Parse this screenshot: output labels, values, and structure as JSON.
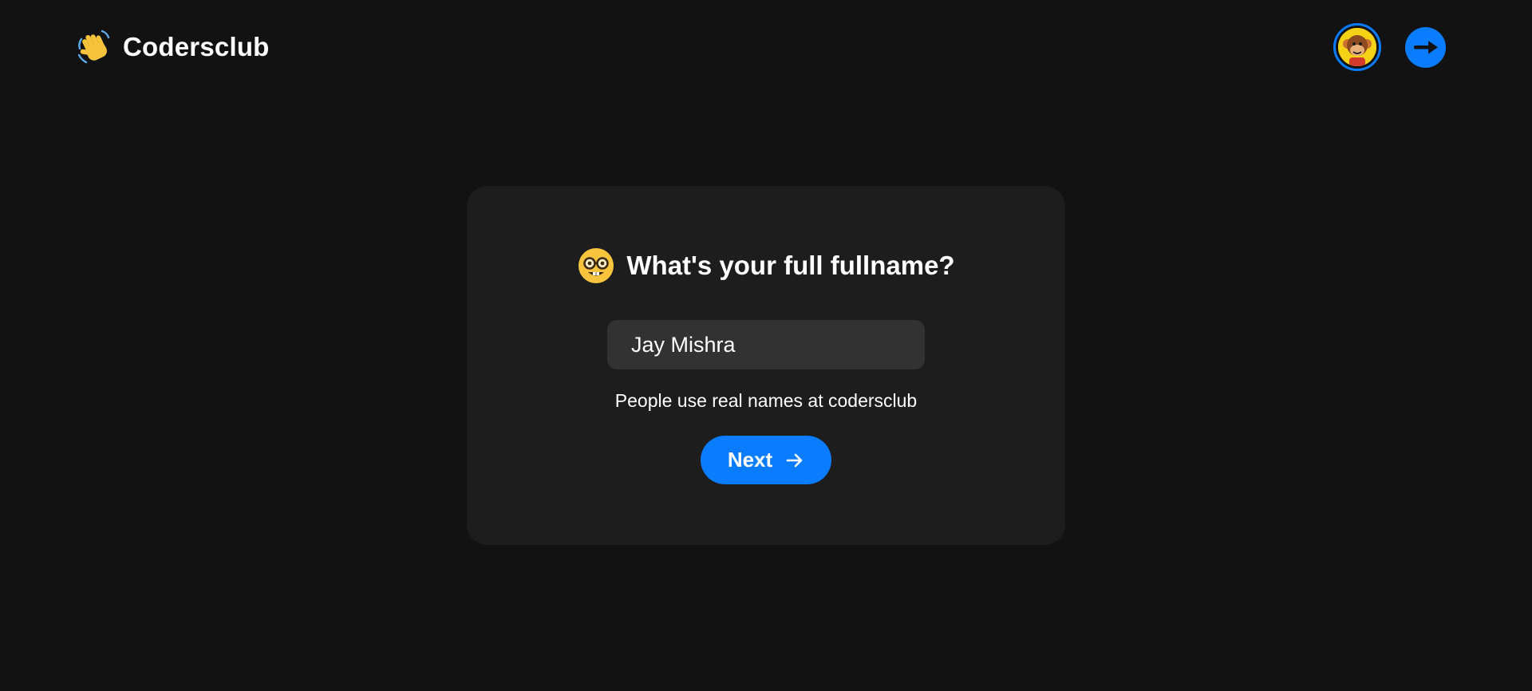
{
  "header": {
    "brand_icon": "waving-hand-icon",
    "brand_name": "Codersclub",
    "avatar_icon": "monkey-avatar-icon",
    "logout_icon": "arrow-right-icon"
  },
  "card": {
    "heading_icon": "nerd-face-emoji-icon",
    "heading": "What's your full fullname?",
    "name_input": {
      "value": "Jay Mishra",
      "placeholder": ""
    },
    "helper_text": "People use real names at codersclub",
    "next_button": {
      "label": "Next",
      "icon": "arrow-right-icon"
    }
  },
  "colors": {
    "background": "#121212",
    "card": "#1d1d1d",
    "input": "#323232",
    "accent": "#0a7cff"
  }
}
